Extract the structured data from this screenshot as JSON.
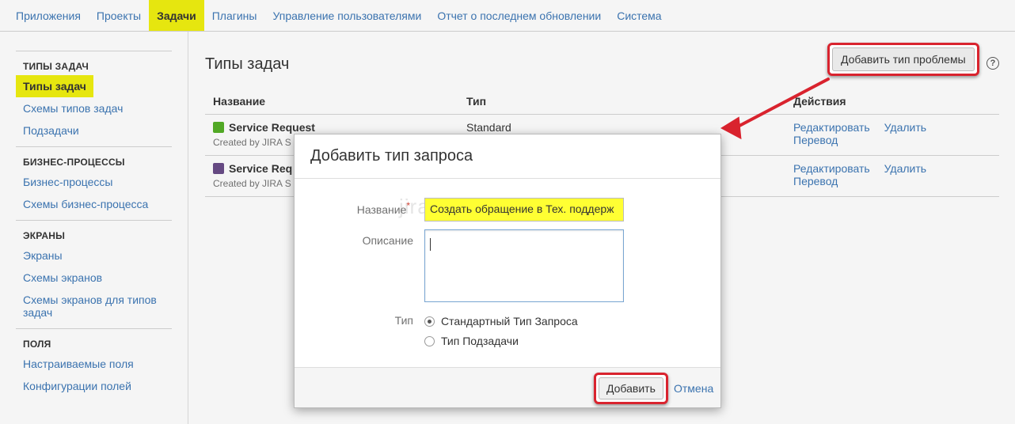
{
  "topnav": {
    "items": [
      {
        "label": "Приложения"
      },
      {
        "label": "Проекты"
      },
      {
        "label": "Задачи",
        "active": true
      },
      {
        "label": "Плагины"
      },
      {
        "label": "Управление пользователями"
      },
      {
        "label": "Отчет о последнем обновлении"
      },
      {
        "label": "Система"
      }
    ]
  },
  "sidebar": {
    "groups": [
      {
        "heading": "ТИПЫ ЗАДАЧ",
        "items": [
          "Типы задач",
          "Схемы типов задач",
          "Подзадачи"
        ]
      },
      {
        "heading": "БИЗНЕС-ПРОЦЕССЫ",
        "items": [
          "Бизнес-процессы",
          "Схемы бизнес-процесса"
        ]
      },
      {
        "heading": "ЭКРАНЫ",
        "items": [
          "Экраны",
          "Схемы экранов",
          "Схемы экранов для типов задач"
        ]
      },
      {
        "heading": "ПОЛЯ",
        "items": [
          "Настраиваемые поля",
          "Конфигурации полей"
        ]
      }
    ]
  },
  "main": {
    "title": "Типы задач",
    "add_button": "Добавить тип проблемы",
    "help_glyph": "?",
    "table": {
      "headers": [
        "Название",
        "Тип",
        "Действия"
      ],
      "rows": [
        {
          "name": "Service Request",
          "sub": "Created by JIRA S",
          "type": "Standard",
          "icon_color": "#51a825",
          "actions": [
            "Редактировать",
            "Удалить",
            "Перевод"
          ]
        },
        {
          "name": "Service Req",
          "sub": "Created by JIRA S",
          "type": "",
          "icon_color": "#654982",
          "actions": [
            "Редактировать",
            "Удалить",
            "Перевод"
          ]
        }
      ]
    }
  },
  "modal": {
    "title": "Добавить тип запроса",
    "name_label": "Название",
    "required_mark": "*",
    "name_value": "Создать обращение в Тех. поддерж",
    "desc_label": "Описание",
    "desc_value": "",
    "type_label": "Тип",
    "type_options": [
      {
        "label": "Стандартный Тип Запроса",
        "checked": true
      },
      {
        "label": "Тип Подзадачи",
        "checked": false
      }
    ],
    "submit": "Добавить",
    "cancel": "Отмена",
    "watermark": "jirafordummies.ru"
  },
  "colors": {
    "accent_yellow": "#e6e60f",
    "link_blue": "#3b73af",
    "highlight_red": "#d9232e"
  }
}
